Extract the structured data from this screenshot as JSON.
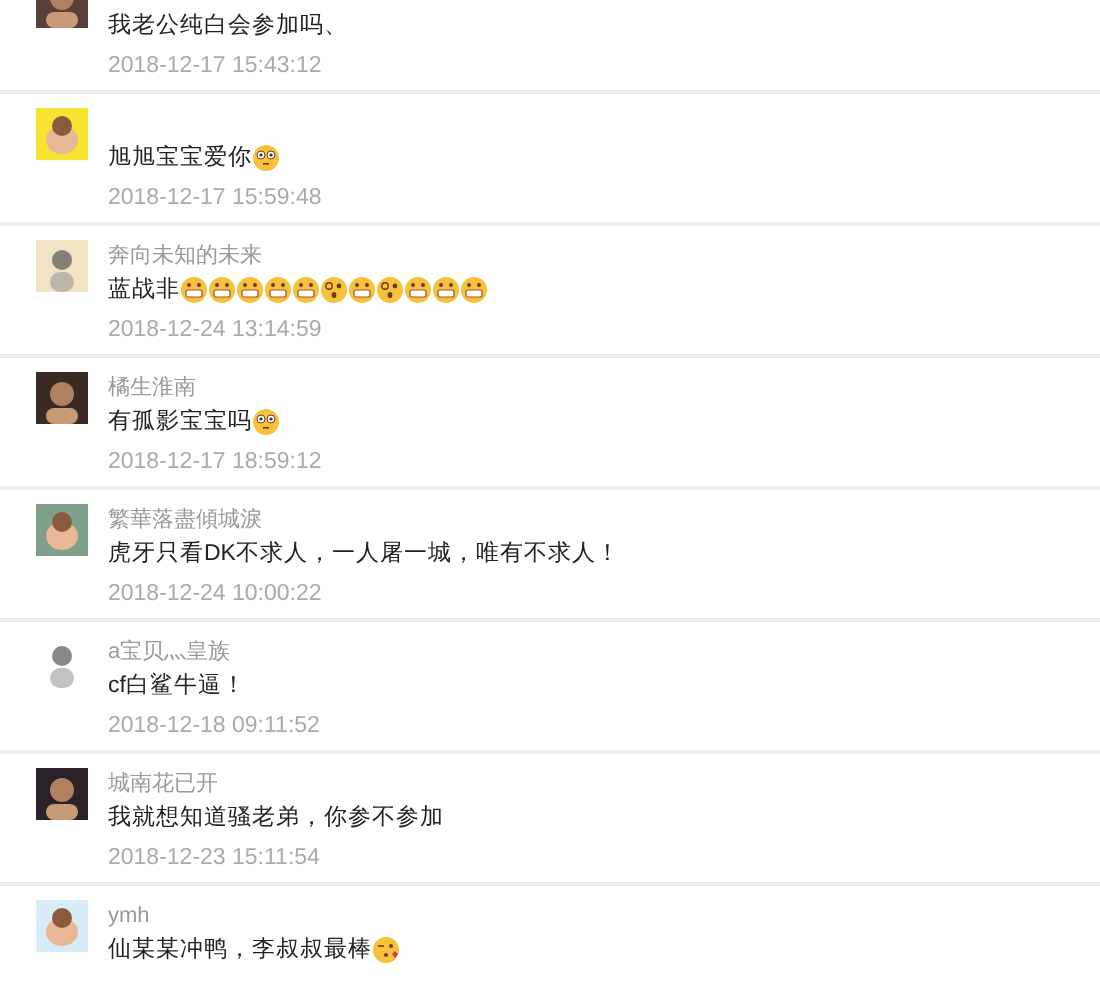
{
  "comments": [
    {
      "text": "我老公纯白会参加吗、",
      "time": "2018-12-17 15:43:12"
    },
    {
      "text": "旭旭宝宝爱你",
      "emojis": [
        {
          "kind": "flushed"
        }
      ],
      "time": "2018-12-17 15:59:48"
    },
    {
      "name": "奔向未知的未来",
      "text": "蓝战非",
      "emojis": [
        {
          "kind": "grin"
        },
        {
          "kind": "grin"
        },
        {
          "kind": "grin"
        },
        {
          "kind": "grin"
        },
        {
          "kind": "grin"
        },
        {
          "kind": "dizzy"
        },
        {
          "kind": "grin"
        },
        {
          "kind": "dizzy"
        },
        {
          "kind": "grin"
        },
        {
          "kind": "grin"
        },
        {
          "kind": "grin"
        }
      ],
      "time": "2018-12-24 13:14:59"
    },
    {
      "name": "橘生淮南",
      "text": "有孤影宝宝吗",
      "emojis": [
        {
          "kind": "flushed"
        }
      ],
      "time": "2018-12-17 18:59:12"
    },
    {
      "name": "繁華落盡傾城淚",
      "text": "虎牙只看DK不求人，一人屠一城，唯有不求人！",
      "time": "2018-12-24 10:00:22"
    },
    {
      "name": "a宝贝灬皇族",
      "text": "cf白鲨牛逼！",
      "time": "2018-12-18 09:11:52"
    },
    {
      "name": "城南花已开",
      "text": "我就想知道骚老弟，你参不参加",
      "time": "2018-12-23 15:11:54"
    },
    {
      "name": "ymh",
      "text": "仙某某冲鸭，李叔叔最棒",
      "emojis": [
        {
          "kind": "kiss"
        }
      ]
    }
  ]
}
